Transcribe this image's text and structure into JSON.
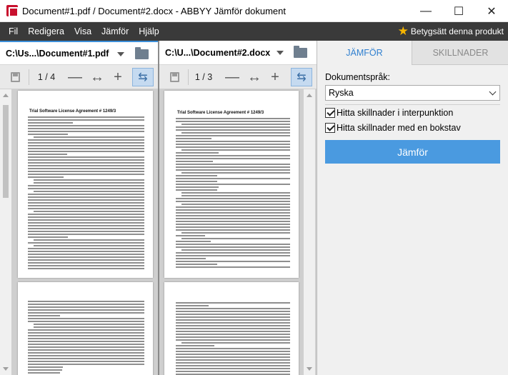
{
  "window": {
    "title": "Document#1.pdf / Document#2.docx - ABBYY Jämför dokument",
    "minimize": "—",
    "maximize": "☐",
    "close": "✕"
  },
  "menu": {
    "items": [
      "Fil",
      "Redigera",
      "Visa",
      "Jämför",
      "Hjälp"
    ],
    "rate_label": "Betygsätt denna produkt"
  },
  "left_doc": {
    "name": "C:\\Us...\\Document#1.pdf",
    "page_indicator": "1 / 4",
    "page1_title": "Trial Software License Agreement # 1249/3"
  },
  "right_doc": {
    "name": "C:\\U...\\Document#2.docx",
    "page_indicator": "1 / 3",
    "page1_title": "Trial Software License Agreement # 1249/3"
  },
  "toolbar_symbols": {
    "zoom_out": "—",
    "fit_width": "↔",
    "zoom_in": "+",
    "sync": "⇆"
  },
  "side": {
    "tab_compare": "JÄMFÖR",
    "tab_differences": "SKILLNADER",
    "language_label": "Dokumentspråk:",
    "language_value": "Ryska",
    "check_punctuation": "Hitta skillnader i interpunktion",
    "check_one_letter": "Hitta skillnader med en bokstav",
    "compare_button": "Jämför"
  },
  "colors": {
    "accent": "#3c8fd9",
    "button": "#4a9ae0",
    "menubar": "#3a3a3a",
    "star": "#f4b400"
  }
}
